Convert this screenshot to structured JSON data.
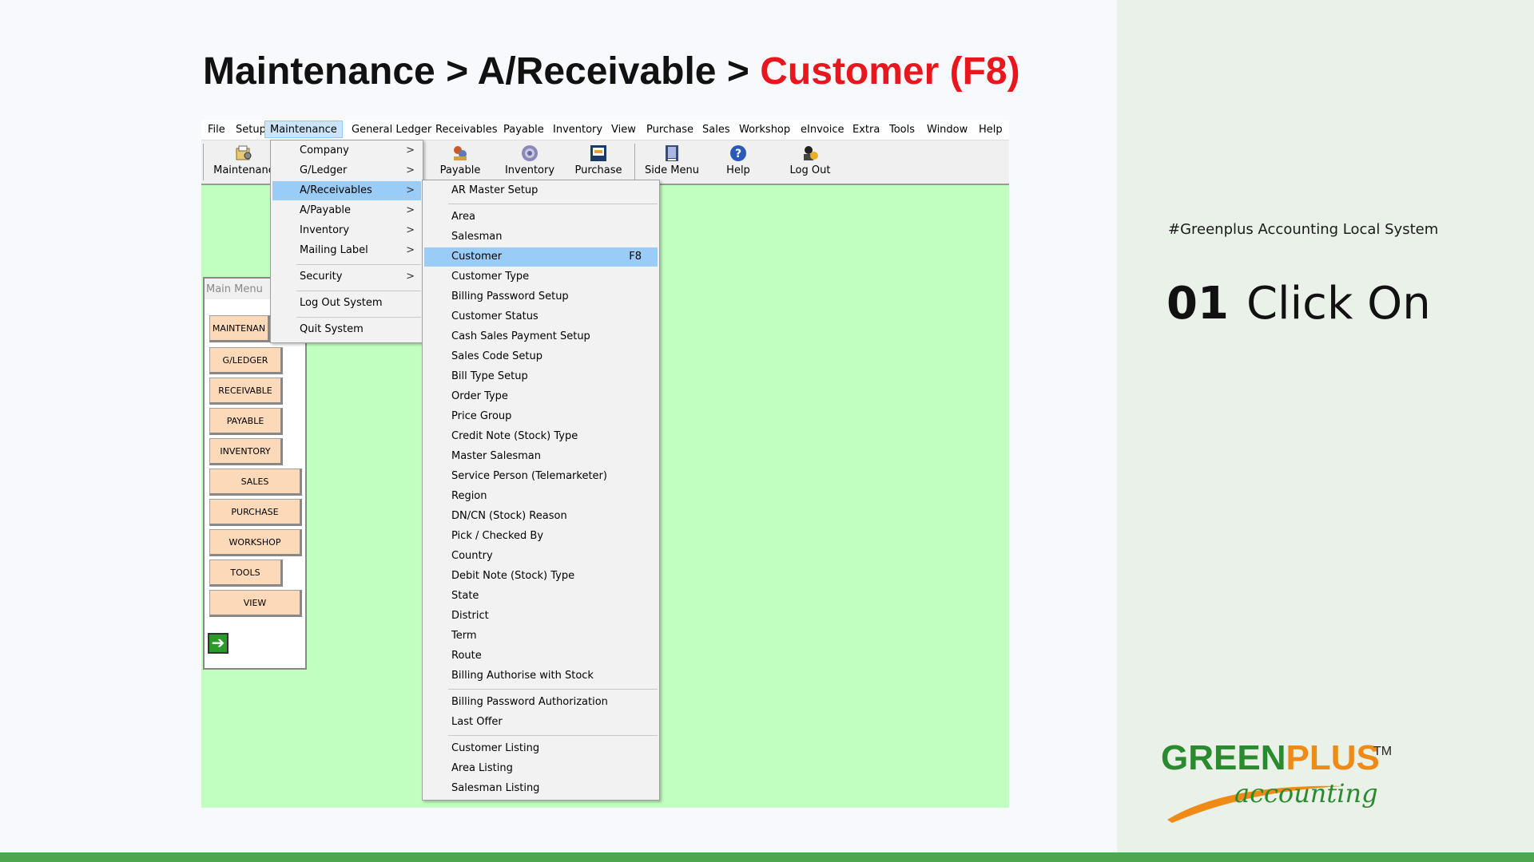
{
  "slide": {
    "title_prefix": "Maintenance > A/Receivable > ",
    "title_highlight": "Customer (F8)",
    "hashtag": "#Greenplus Accounting Local System",
    "step_number": "01",
    "step_text": "Click On",
    "colors": {
      "highlight": "#e8171d",
      "bottom_bar": "#4ea64e",
      "right_panel": "#e9f1e8"
    },
    "logo": {
      "word1": "GREEN",
      "word2": "PLUS",
      "tm": "TM",
      "sub": "accounting"
    }
  },
  "menubar": [
    "File",
    "Setup",
    "Maintenance",
    "General Ledger",
    "Receivables",
    "Payable",
    "Inventory",
    "View",
    "Purchase",
    "Sales",
    "Workshop",
    "eInvoice",
    "Extra",
    "Tools",
    "Window",
    "Help"
  ],
  "active_menu": "Maintenance",
  "toolbar": [
    {
      "label": "Maintenanc",
      "icon": "maintenance-icon"
    },
    {
      "label": "Payable",
      "icon": "payable-icon"
    },
    {
      "label": "Inventory",
      "icon": "gear-icon"
    },
    {
      "label": "Purchase",
      "icon": "purchase-icon"
    },
    {
      "label": "Side Menu",
      "icon": "side-menu-icon"
    },
    {
      "label": "Help",
      "icon": "help-icon"
    },
    {
      "label": "Log Out",
      "icon": "logout-icon"
    }
  ],
  "main_menu": {
    "title": "Main Menu",
    "buttons": [
      "MAINTENAN",
      "G/LEDGER",
      "RECEIVABLE",
      "PAYABLE",
      "INVENTORY",
      "SALES",
      "PURCHASE",
      "WORKSHOP",
      "TOOLS",
      "VIEW"
    ]
  },
  "maintenance_menu": [
    {
      "label": "Company",
      "submenu": true
    },
    {
      "label": "G/Ledger",
      "submenu": true
    },
    {
      "label": "A/Receivables",
      "submenu": true,
      "selected": true
    },
    {
      "label": "A/Payable",
      "submenu": true
    },
    {
      "label": "Inventory",
      "submenu": true
    },
    {
      "label": "Mailing Label",
      "submenu": true
    },
    {
      "label": "Security",
      "submenu": true
    },
    {
      "label": "Log Out System",
      "submenu": false
    },
    {
      "label": "Quit System",
      "submenu": false
    }
  ],
  "submenu_arrow": ">",
  "receivables_menu": [
    "AR Master Setup",
    "Area",
    "Salesman",
    "Customer",
    "Customer Type",
    "Billing Password Setup",
    "Customer Status",
    "Cash Sales Payment Setup",
    "Sales Code Setup",
    "Bill Type Setup",
    "Order Type",
    "Price Group",
    "Credit Note (Stock) Type",
    "Master Salesman",
    "Service Person (Telemarketer)",
    "Region",
    "DN/CN (Stock) Reason",
    "Pick / Checked By",
    "Country",
    "Debit Note (Stock) Type",
    "State",
    "District",
    "Term",
    "Route",
    "Billing Authorise with Stock",
    "Billing Password Authorization",
    "Last Offer",
    "Customer Listing",
    "Area Listing",
    "Salesman Listing"
  ],
  "selected_item": "Customer",
  "selected_shortcut": "F8"
}
